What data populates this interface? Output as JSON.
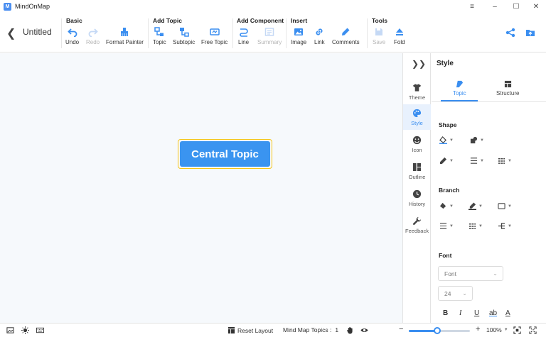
{
  "window": {
    "app_name": "MindOnMap",
    "logo_letter": "M",
    "menu_icon": "hamburger-menu-icon",
    "minimize_icon": "minimize-icon",
    "maximize_icon": "maximize-icon",
    "close_icon": "close-icon"
  },
  "document": {
    "title": "Untitled"
  },
  "toolbar": {
    "groups": {
      "basic": "Basic",
      "add_topic": "Add Topic",
      "add_component": "Add Component",
      "insert": "Insert",
      "tools": "Tools"
    },
    "undo": "Undo",
    "redo": "Redo",
    "format_painter": "Format Painter",
    "topic": "Topic",
    "subtopic": "Subtopic",
    "free_topic": "Free Topic",
    "line": "Line",
    "summary": "Summary",
    "image": "Image",
    "link": "Link",
    "comments": "Comments",
    "save": "Save",
    "fold": "Fold"
  },
  "canvas": {
    "central_topic": "Central Topic"
  },
  "sidebar": {
    "theme": "Theme",
    "style": "Style",
    "icon": "Icon",
    "outline": "Outline",
    "history": "History",
    "feedback": "Feedback"
  },
  "panel": {
    "title": "Style",
    "tab_topic": "Topic",
    "tab_structure": "Structure",
    "section_shape": "Shape",
    "section_branch": "Branch",
    "section_font": "Font",
    "font_family": "Font",
    "font_size": "24",
    "bold": "B",
    "italic": "I",
    "underline": "U",
    "strike": "ab",
    "color": "A"
  },
  "status": {
    "reset_layout": "Reset Layout",
    "topics_label": "Mind Map Topics :",
    "topics_count": "1",
    "zoom_level": "100%",
    "zoom_fraction": 0.47,
    "minus": "−",
    "plus": "+"
  },
  "colors": {
    "accent": "#3a8ef0",
    "central_fill": "#3a94f0",
    "selection": "#f5c518"
  }
}
